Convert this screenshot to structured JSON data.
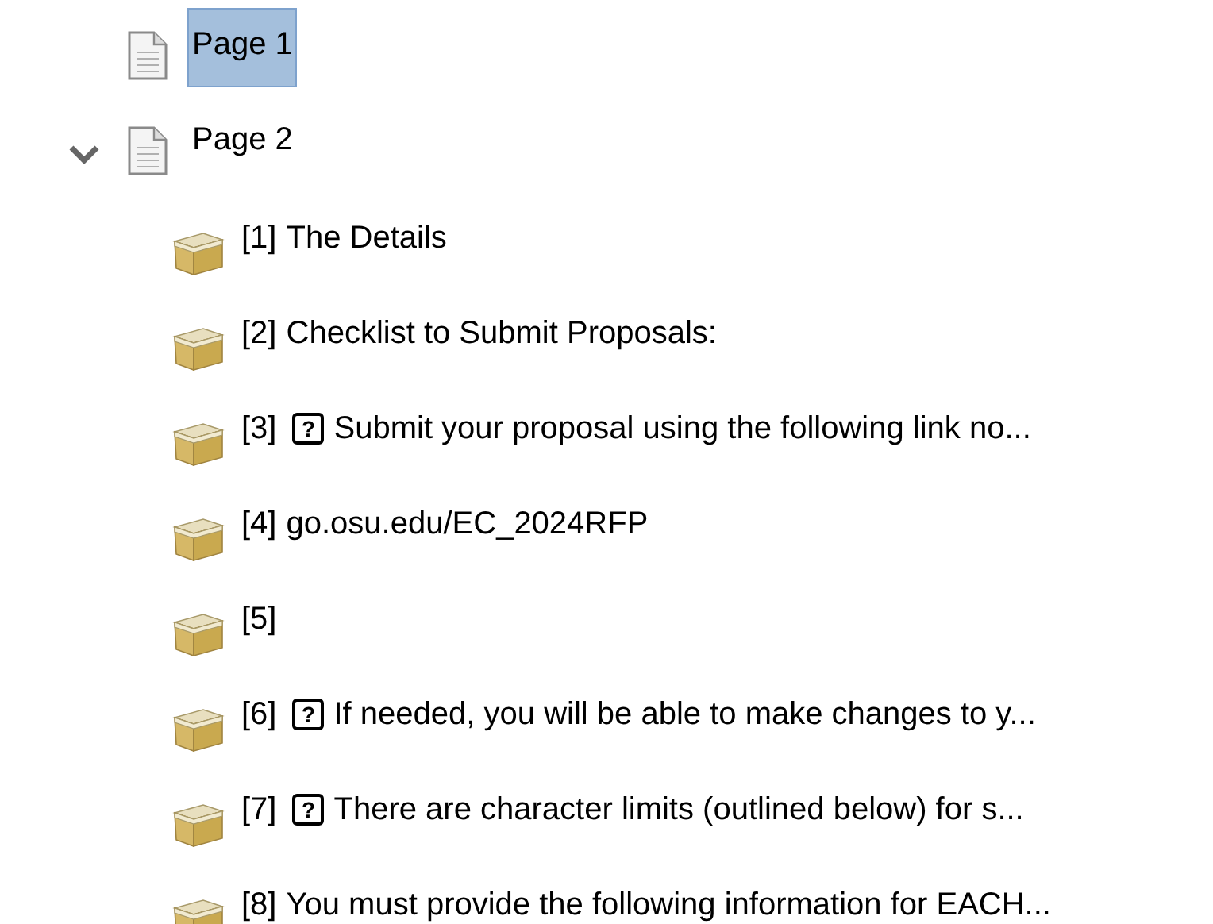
{
  "pages": [
    {
      "label": "Page 1",
      "selected": true
    },
    {
      "label": "Page 2",
      "selected": false,
      "expanded": true,
      "children": [
        {
          "index": "[1]",
          "text": "The Details"
        },
        {
          "index": "[2]",
          "text": "Checklist to Submit Proposals:"
        },
        {
          "index": "[3]",
          "glyph": "?",
          "text": "Submit your proposal using the following link no..."
        },
        {
          "index": "[4]",
          "text": "go.osu.edu/EC_2024RFP"
        },
        {
          "index": "[5]"
        },
        {
          "index": "[6]",
          "glyph": "?",
          "text": "If needed, you will be able to make changes to y..."
        },
        {
          "index": "[7]",
          "glyph": "?",
          "text": "There are character limits (outlined below) for s..."
        },
        {
          "index": "[8]",
          "text": "You must provide the following information for EACH..."
        }
      ]
    }
  ]
}
